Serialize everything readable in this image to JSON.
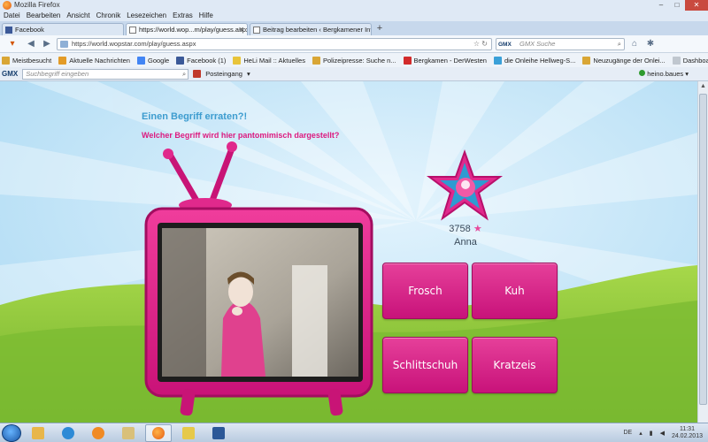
{
  "window": {
    "title": "Mozilla Firefox",
    "controls": [
      "–",
      "□",
      "✕"
    ]
  },
  "menu": {
    "items": [
      "Datei",
      "Bearbeiten",
      "Ansicht",
      "Chronik",
      "Lesezeichen",
      "Extras",
      "Hilfe"
    ]
  },
  "tabs": [
    {
      "label": "Facebook",
      "icon": "facebook-icon",
      "active": false
    },
    {
      "label": "https://world.wop...m/play/guess.aspx",
      "icon": "page-icon",
      "active": true
    },
    {
      "label": "Beitrag bearbeiten ‹ Bergkamener Inf...",
      "icon": "page-icon",
      "active": false
    }
  ],
  "new_tab_label": "+",
  "toolbar": {
    "url": "https://world.wopstar.com/play/guess.aspx",
    "search_engine": "GMX",
    "search_placeholder": "GMX Suche",
    "firefox_menu_label": "▾"
  },
  "bookmarks": [
    {
      "label": "Meistbesucht",
      "color": "#d9a635"
    },
    {
      "label": "Aktuelle Nachrichten",
      "color": "#e39b27"
    },
    {
      "label": "Google",
      "color": "#4285f4"
    },
    {
      "label": "Facebook (1)",
      "color": "#3b5998"
    },
    {
      "label": "HeLi Mail :: Aktuelles",
      "color": "#e8c43a"
    },
    {
      "label": "Polizeipresse: Suche n...",
      "color": "#d9a635"
    },
    {
      "label": "Bergkamen - DerWesten",
      "color": "#d22b2b"
    },
    {
      "label": "die Onleihe Hellweg-S...",
      "color": "#3aa0d8"
    },
    {
      "label": "Neuzugänge der Onlei...",
      "color": "#d9a635"
    },
    {
      "label": "Dashboard ‹ Bergkame...",
      "color": "#c0c7cf"
    }
  ],
  "gmx_bar": {
    "logo": "GMX",
    "search_placeholder": "Suchbegriff eingeben",
    "mail_label": "Posteingang",
    "user": "heino.baues"
  },
  "game": {
    "title": "Einen Begriff erraten?!",
    "question": "Welcher Begriff wird hier pantomimisch dargestellt?",
    "player": {
      "score": "3758",
      "score_icon": "star-icon",
      "name": "Anna"
    },
    "answers": [
      "Frosch",
      "Kuh",
      "Schlittschuh",
      "Kratzeis"
    ]
  },
  "taskbar": {
    "language": "DE",
    "time": "11:31",
    "date": "24.02.2013",
    "apps": [
      "folder-icon",
      "internet-explorer-icon",
      "media-player-icon",
      "explorer-icon",
      "firefox-icon",
      "paint-icon",
      "word-icon"
    ]
  },
  "colors": {
    "accent_pink": "#dc1a7f",
    "title_blue": "#3d9ccf",
    "sky_blue": "#a8d8f3",
    "grass_green": "#8cc63f"
  }
}
